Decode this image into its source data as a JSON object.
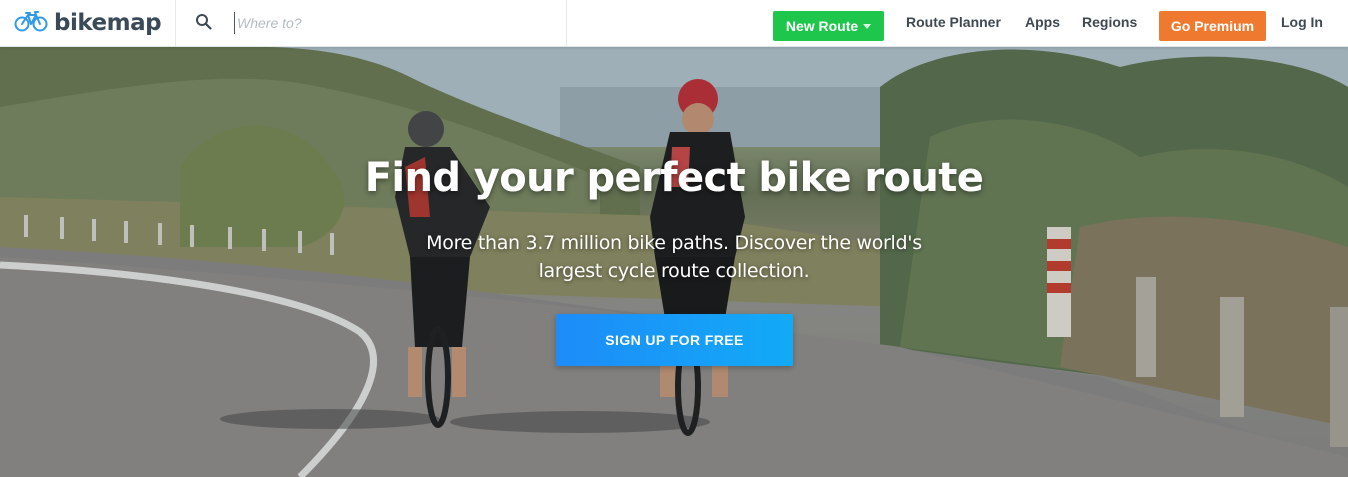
{
  "header": {
    "logo_text": "bikemap",
    "logo_icon": "bicycle-icon",
    "search": {
      "placeholder": "Where to?",
      "value": "",
      "icon": "search-icon"
    },
    "new_route_label": "New Route",
    "nav": {
      "route_planner": "Route Planner",
      "apps": "Apps",
      "regions": "Regions"
    },
    "premium_label": "Go Premium",
    "login_label": "Log In"
  },
  "hero": {
    "title": "Find your perfect bike route",
    "subtitle": "More than 3.7 million bike paths. Discover the world's largest cycle route collection.",
    "cta_label": "SIGN UP FOR FREE"
  },
  "colors": {
    "brand_blue": "#1d8cf8",
    "new_route_green": "#1fc64c",
    "premium_orange": "#ef7a2f",
    "logo_text": "#3a4a57",
    "logo_icon": "#2f9be6"
  }
}
